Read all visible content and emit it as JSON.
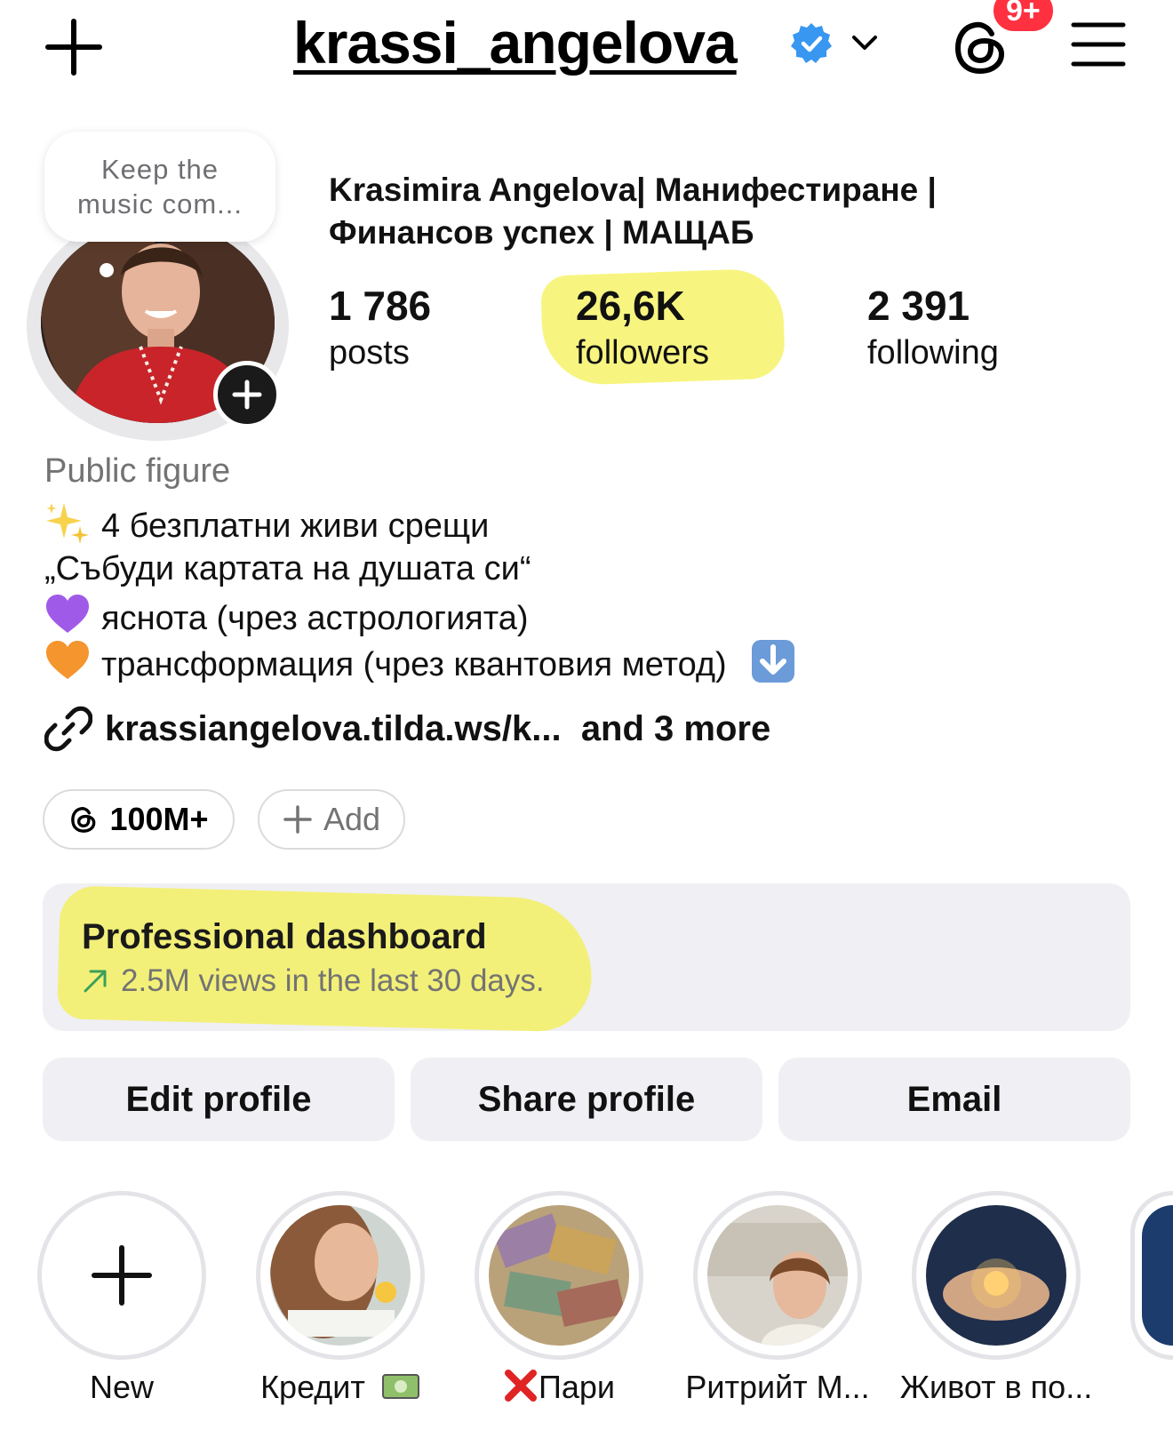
{
  "header": {
    "username": "krassi_angelova",
    "notifications_badge": "9+",
    "icons": [
      "plus-icon",
      "verified-icon",
      "chevron-down-icon",
      "threads-icon",
      "menu-icon"
    ]
  },
  "profile": {
    "note_bubble": [
      "Keep the",
      "music com..."
    ],
    "full_name_line1": "Krasimira Angelova| Манифестиране |",
    "full_name_line2": "Финансов успех | МАЩАБ",
    "stats": [
      {
        "value": "1 786",
        "label": "posts"
      },
      {
        "value": "26,6K",
        "label": "followers"
      },
      {
        "value": "2 391",
        "label": "following"
      }
    ]
  },
  "bio": {
    "category": "Public figure",
    "lines": [
      "4 безплатни живи срещи",
      "„Събуди картата на душата си“",
      "яснота (чрез астрологията)",
      "трансформация (чрез квантовия метод)"
    ],
    "link": "krassiangelova.tilda.ws/k...",
    "link_more": "and 3 more"
  },
  "chips": {
    "threads_count": "100M+",
    "add_label": "Add"
  },
  "dashboard": {
    "title": "Professional dashboard",
    "subtitle": "2.5M views in the last 30 days."
  },
  "actions": {
    "edit": "Edit profile",
    "share": "Share profile",
    "email": "Email"
  },
  "highlights": [
    {
      "label": "New"
    },
    {
      "label": "Кредит"
    },
    {
      "label": "Пари"
    },
    {
      "label": "Ритрийт М..."
    },
    {
      "label": "Живот в по..."
    }
  ],
  "colors": {
    "verified": "#3897f0",
    "badge": "#ff3040",
    "highlighter": "#f6f36a",
    "button_bg": "#efeff4"
  }
}
